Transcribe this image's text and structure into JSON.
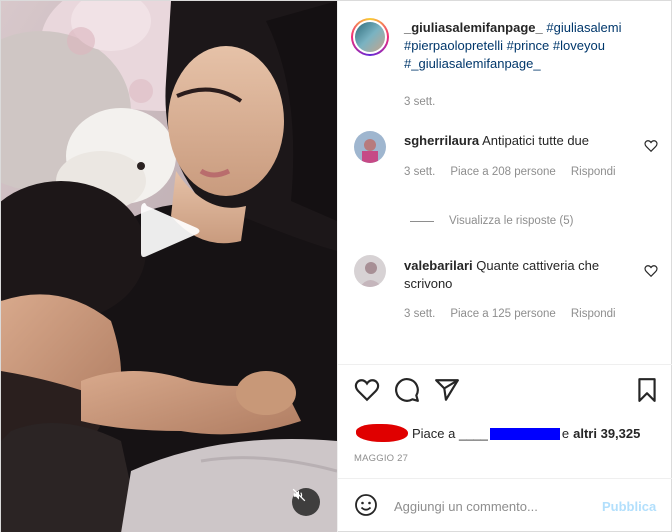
{
  "post": {
    "username": "_giuliasalemifanpage_",
    "hashtags": [
      "#giuliasalemi",
      "#pierpaolopretelli",
      "#prince",
      "#loveyou",
      "#_giuliasalemifanpage_"
    ],
    "time": "3 sett."
  },
  "comments": [
    {
      "username": "sgherrilaura",
      "text": "Antipatici tutte due",
      "time": "3 sett.",
      "likes": "Piace a 208 persone",
      "reply": "Rispondi"
    },
    {
      "username": "valebarilari",
      "text": "Quante cattiveria che scrivono",
      "time": "3 sett.",
      "likes": "Piace a 125 persone",
      "reply": "Rispondi"
    }
  ],
  "view_replies": "Visualizza le risposte (5)",
  "likes_line": {
    "prefix": "Piace a ____",
    "suffix_plain": "e",
    "suffix_bold": "altri 39,325"
  },
  "date": "MAGGIO 27",
  "add_comment": {
    "placeholder": "Aggiungi un commento...",
    "publish": "Pubblica"
  },
  "icons": {
    "play": "play-icon",
    "mute": "volume-muted-icon",
    "like": "heart-icon",
    "comment": "comment-icon",
    "share": "paper-plane-icon",
    "save": "bookmark-icon",
    "emoji": "smiley-icon"
  },
  "colors": {
    "hashtag": "#00376b",
    "secondary_text": "#8e8e8e",
    "publish_disabled": "#b2dffc"
  }
}
